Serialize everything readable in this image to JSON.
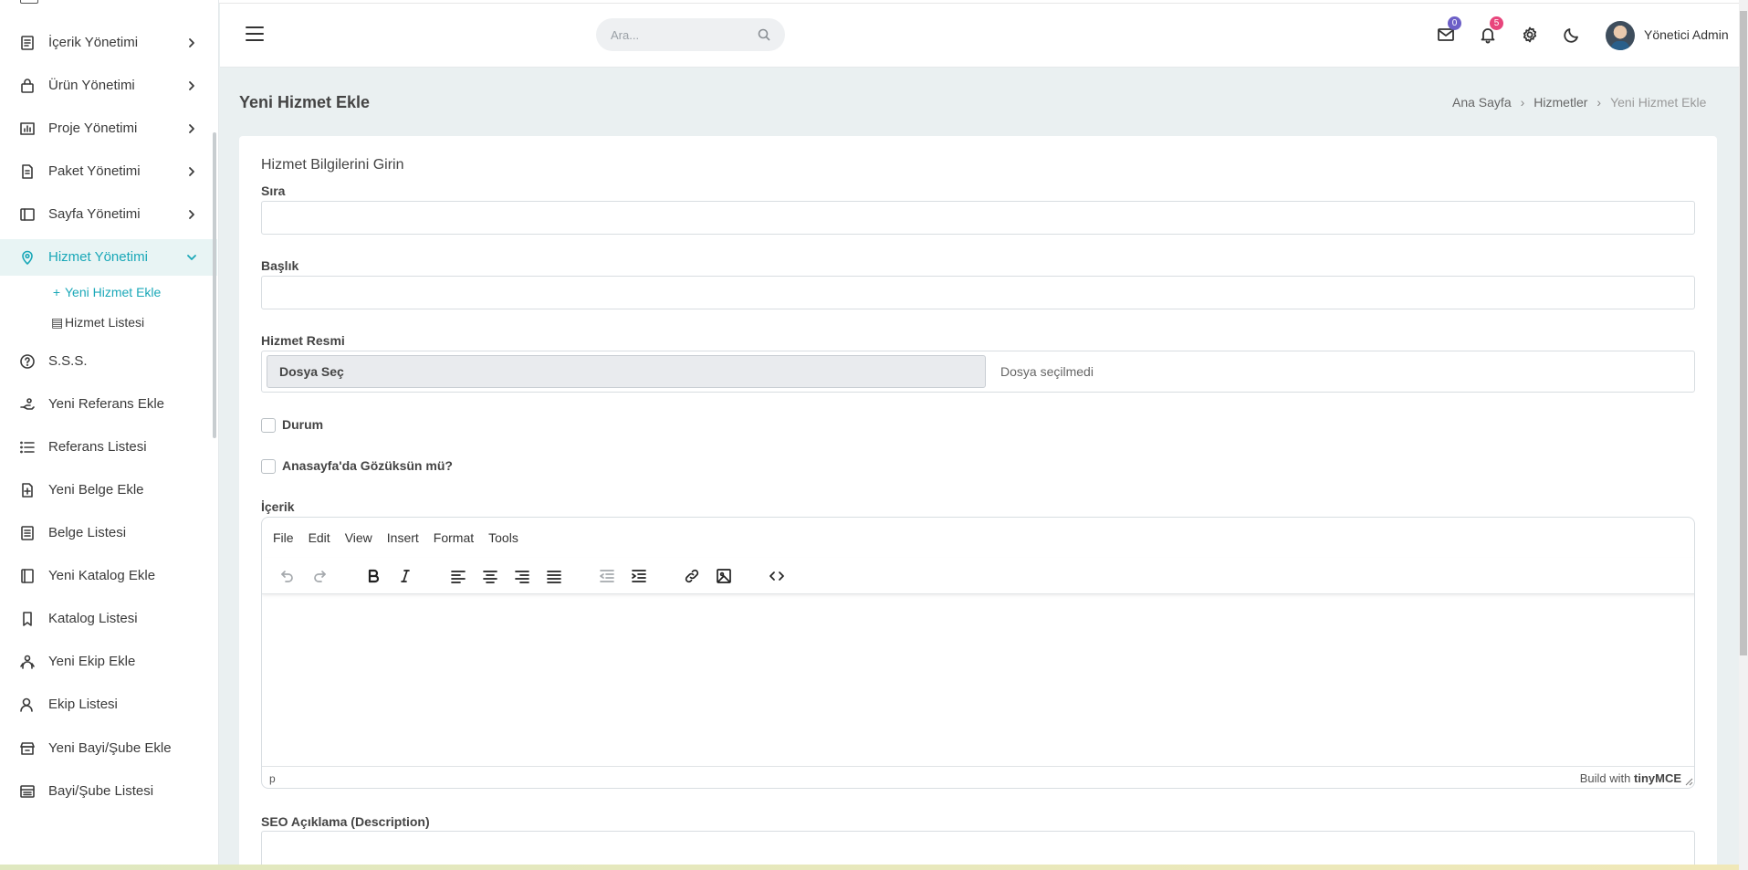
{
  "sidebar": {
    "items": [
      {
        "label": "İçerik Yönetimi",
        "icon": "document-icon",
        "has_children": true
      },
      {
        "label": "Ürün Yönetimi",
        "icon": "bag-icon",
        "has_children": true
      },
      {
        "label": "Proje Yönetimi",
        "icon": "chart-icon",
        "has_children": true
      },
      {
        "label": "Paket Yönetimi",
        "icon": "file-icon",
        "has_children": true
      },
      {
        "label": "Sayfa Yönetimi",
        "icon": "layout-icon",
        "has_children": true
      },
      {
        "label": "Hizmet Yönetimi",
        "icon": "location-pin-icon",
        "has_children": true,
        "active": true
      },
      {
        "label": "S.S.S.",
        "icon": "help-circle-icon"
      },
      {
        "label": "Yeni Referans Ekle",
        "icon": "hand-icon"
      },
      {
        "label": "Referans Listesi",
        "icon": "list-icon"
      },
      {
        "label": "Yeni Belge Ekle",
        "icon": "file-plus-icon"
      },
      {
        "label": "Belge Listesi",
        "icon": "file-list-icon"
      },
      {
        "label": "Yeni Katalog Ekle",
        "icon": "book-icon"
      },
      {
        "label": "Katalog Listesi",
        "icon": "bookmark-icon"
      },
      {
        "label": "Yeni Ekip Ekle",
        "icon": "team-icon"
      },
      {
        "label": "Ekip Listesi",
        "icon": "user-icon"
      },
      {
        "label": "Yeni Bayi/Şube Ekle",
        "icon": "store-icon"
      },
      {
        "label": "Bayi/Şube Listesi",
        "icon": "store-list-icon"
      }
    ],
    "sub_items": [
      {
        "label": "Yeni Hizmet Ekle",
        "icon": "+",
        "active": true
      },
      {
        "label": "Hizmet Listesi",
        "icon": "▤"
      }
    ]
  },
  "topbar": {
    "search_placeholder": "Ara...",
    "mail_count": "0",
    "notification_count": "5",
    "user_name": "Yönetici Admin",
    "colors": {
      "mail_badge": "#6c5fc7",
      "notification_badge": "#e8457c"
    }
  },
  "page": {
    "title": "Yeni Hizmet Ekle",
    "breadcrumb": [
      "Ana Sayfa",
      "Hizmetler",
      "Yeni Hizmet Ekle"
    ]
  },
  "form": {
    "title": "Hizmet Bilgilerini Girin",
    "sira_label": "Sıra",
    "baslik_label": "Başlık",
    "resim_label": "Hizmet Resmi",
    "file_button": "Dosya Seç",
    "file_status": "Dosya seçilmedi",
    "durum_label": "Durum",
    "anasayfa_label": "Anasayfa'da Gözüksün mü?",
    "icerik_label": "İçerik",
    "seo_label": "SEO Açıklama (Description)"
  },
  "editor": {
    "menu": [
      "File",
      "Edit",
      "View",
      "Insert",
      "Format",
      "Tools"
    ],
    "path": "p",
    "brand_prefix": "Build with",
    "brand_name": "tinyMCE"
  },
  "accent_color": "#1aa8b8"
}
